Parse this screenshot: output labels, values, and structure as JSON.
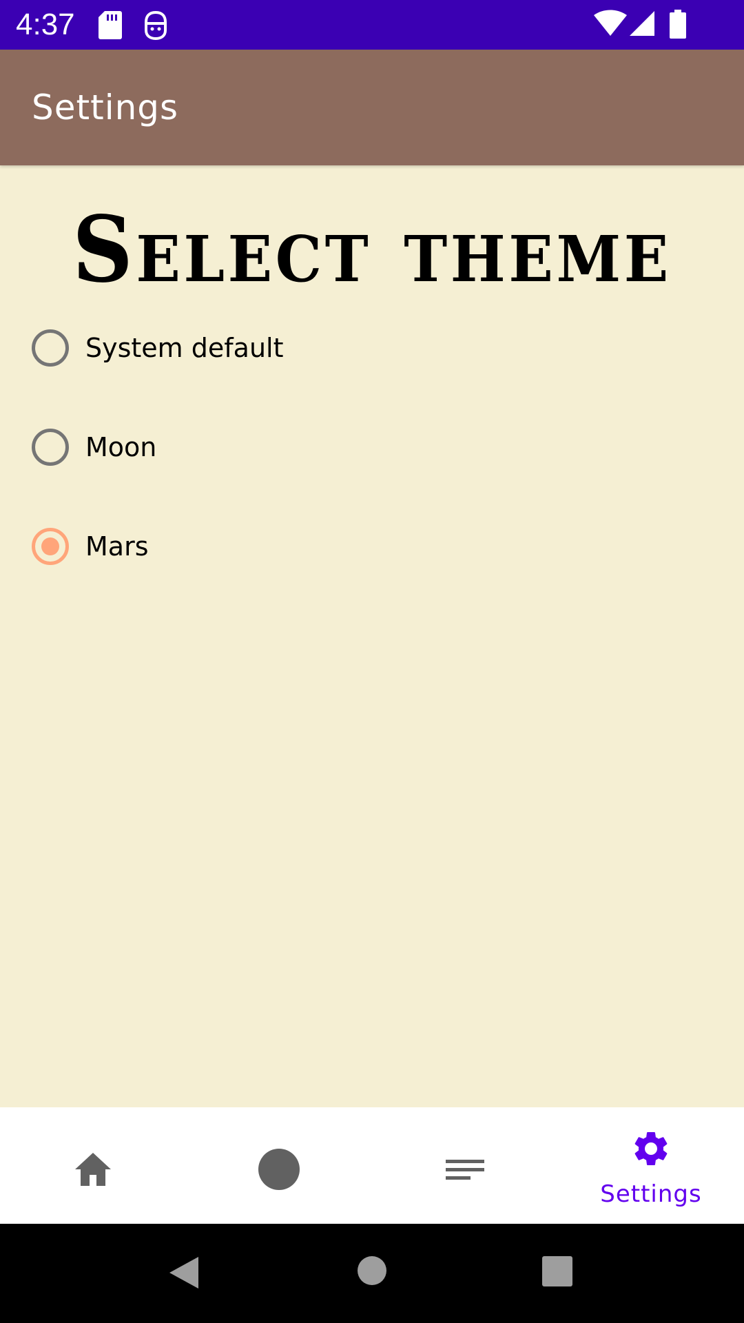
{
  "status_bar": {
    "time": "4:37",
    "icons": [
      "sd-card-icon",
      "robot-icon",
      "wifi-icon",
      "signal-icon",
      "battery-icon"
    ],
    "background": "#3b00b3"
  },
  "app_bar": {
    "title": "Settings",
    "background": "#8d6b5d"
  },
  "content": {
    "heading": "Select theme",
    "background": "#f5efd3",
    "theme_options": [
      {
        "label": "System default",
        "selected": false
      },
      {
        "label": "Moon",
        "selected": false
      },
      {
        "label": "Mars",
        "selected": true
      }
    ],
    "selected_color": "#ffa57a"
  },
  "bottom_nav": {
    "items": [
      {
        "icon": "home-icon",
        "label": "",
        "active": false
      },
      {
        "icon": "circle-icon",
        "label": "",
        "active": false
      },
      {
        "icon": "list-icon",
        "label": "",
        "active": false
      },
      {
        "icon": "gear-icon",
        "label": "Settings",
        "active": true
      }
    ],
    "active_color": "#6200ee",
    "inactive_color": "#616161"
  },
  "system_nav": {
    "buttons": [
      "back-icon",
      "home-circle-icon",
      "recents-icon"
    ]
  }
}
